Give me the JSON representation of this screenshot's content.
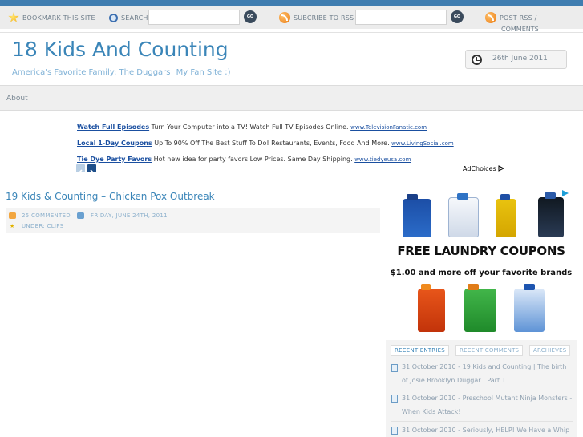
{
  "toolbar": {
    "bookmark_label": "BOOKMARK THIS SITE",
    "search_label": "SEARCH",
    "search_go": "GO",
    "subscribe_label": "SUBCRIBE TO RSS",
    "subscribe_go": "GO",
    "post_rss_label": "POST RSS /",
    "comments_label": "COMMENTS"
  },
  "header": {
    "title": "18 Kids And Counting",
    "tagline": "America's Favorite Family: The Duggars! My Fan Site ;)",
    "date": "26th June 2011"
  },
  "nav": {
    "items": [
      "About"
    ]
  },
  "ads": [
    {
      "title": "Watch Full Episodes",
      "text": " Turn Your Computer into a TV! Watch Full TV Episodes Online. ",
      "url": "www.TelevisionFanatic.com"
    },
    {
      "title": "Local 1-Day Coupons",
      "text": " Up To 90% Off The Best Stuff To Do! Restaurants, Events, Food And More. ",
      "url": "www.LivingSocial.com"
    },
    {
      "title": "Tie Dye Party Favors",
      "text": " Hot new idea for party favors Low Prices. Same Day Shipping. ",
      "url": "www.tiedyeusa.com"
    }
  ],
  "adchoices": "AdChoices",
  "post": {
    "title": "19 Kids & Counting – Chicken Pox Outbreak",
    "comments": "25 COMMENTED",
    "date": "FRIDAY, JUNE 24TH, 2011",
    "category": "UNDER: CLIPS"
  },
  "display_ad": {
    "headline": "FREE LAUNDRY COUPONS",
    "subline": "$1.00 and more off your favorite brands"
  },
  "sidebar": {
    "tabs": [
      "RECENT ENTRIES",
      "RECENT COMMENTS",
      "ARCHIEVES"
    ],
    "entries": [
      {
        "text": "31 October 2010 - 19 Kids and Counting | The birth of Josie Brooklyn Duggar | Part 1"
      },
      {
        "text": "31 October 2010 - Preschool Mutant Ninja Monsters - When Kids Attack!"
      },
      {
        "text": "31 October 2010 - Seriously, HELP! We Have a Whip"
      }
    ]
  },
  "colors": {
    "brand_blue": "#3a85b8",
    "top_strip": "#3f7db0",
    "link_blue": "#1a4fa0"
  }
}
